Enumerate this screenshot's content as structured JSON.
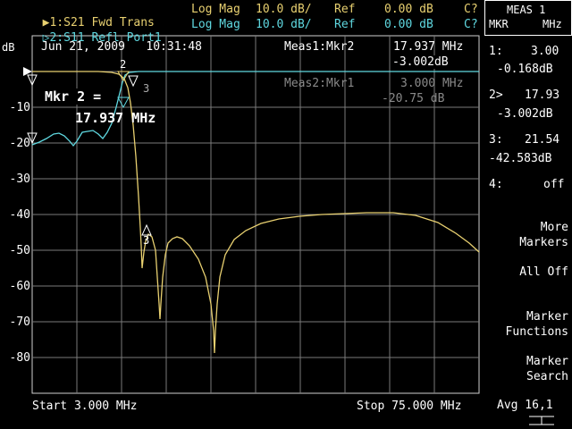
{
  "header": {
    "trace1": {
      "label": "1:S21 Fwd Trans",
      "format": "Log Mag",
      "scale": "10.0 dB/",
      "ref": "Ref",
      "ref_value": "0.00 dB",
      "cal": "C?"
    },
    "trace2": {
      "label": "2:S11 Refl Port1",
      "format": "Log Mag",
      "scale": "10.0 dB/",
      "ref": "Ref",
      "ref_value": "0.00 dB",
      "cal": "C?"
    }
  },
  "plot": {
    "unit": "dB",
    "datetime": "Jun 21, 2009   10:31:48",
    "meas1": {
      "label": "Meas1:Mkr2",
      "freq": "17.937 MHz",
      "value": "-3.002dB"
    },
    "meas2": {
      "label": "Meas2:Mkr1",
      "freq": "3.000 MHz",
      "value": "-20.75 dB"
    },
    "marker_readout": {
      "line1": "Mkr 2 =",
      "line2": "17.937 MHz"
    },
    "marker_tags": {
      "m2": "2",
      "m3a": "3",
      "m3b": "3"
    },
    "yticks": [
      "-10",
      "-20",
      "-30",
      "-40",
      "-50",
      "-60",
      "-70",
      "-80"
    ],
    "start": "Start 3.000 MHz",
    "stop": "Stop 75.000 MHz"
  },
  "sidebar": {
    "title_line1": "MEAS 1",
    "title_mkr": "MKR",
    "title_mhz": "MHz",
    "markers": [
      {
        "id": "1:",
        "freq": "3.00",
        "value": "-0.168dB"
      },
      {
        "id": "2>",
        "freq": "17.93",
        "value": "-3.002dB"
      },
      {
        "id": "3:",
        "freq": "21.54",
        "value": "-42.583dB"
      },
      {
        "id": "4:",
        "freq": "off",
        "value": ""
      }
    ],
    "softkeys": [
      {
        "line1": "More",
        "line2": "Markers"
      },
      {
        "line1": "All Off",
        "line2": ""
      },
      {
        "line1": "Marker",
        "line2": "Functions"
      },
      {
        "line1": "Marker",
        "line2": "Search"
      }
    ],
    "avg": "Avg 16,1"
  },
  "colors": {
    "trace1": "#e8d070",
    "trace2": "#5fd8e0",
    "grid": "#7a7a7a"
  },
  "icons": {
    "trace1_active": "triangle-right-icon",
    "trace2": "triangle-right-outline-icon",
    "ref_arrow": "ref-pointer-icon"
  }
}
